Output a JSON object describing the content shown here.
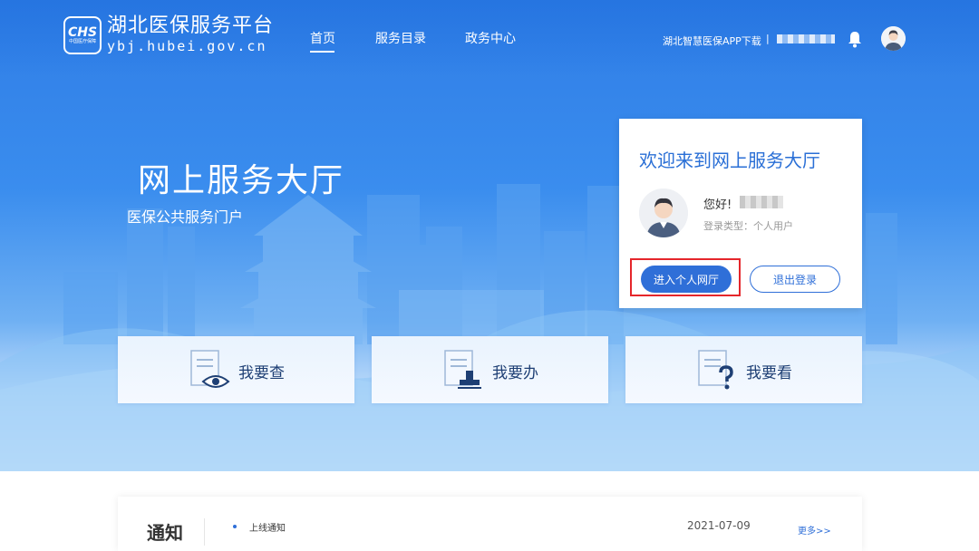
{
  "header": {
    "logo_badge": "CHS",
    "logo_badge_sub": "中国医疗保障",
    "site_name": "湖北医保服务平台",
    "site_domain": "ybj.hubei.gov.cn",
    "nav": [
      {
        "label": "首页",
        "active": true
      },
      {
        "label": "服务目录",
        "active": false
      },
      {
        "label": "政务中心",
        "active": false
      }
    ],
    "app_download": "湖北智慧医保APP下载",
    "separator": "|"
  },
  "hero": {
    "title": "网上服务大厅",
    "subtitle": "医保公共服务门户"
  },
  "login_card": {
    "welcome": "欢迎来到网上服务大厅",
    "greeting": "您好!",
    "login_type": "登录类型：个人用户",
    "enter_button": "进入个人网厅",
    "logout_button": "退出登录"
  },
  "services": [
    {
      "label": "我要查",
      "icon": "document-eye-icon"
    },
    {
      "label": "我要办",
      "icon": "document-stamp-icon"
    },
    {
      "label": "我要看",
      "icon": "document-question-icon"
    }
  ],
  "notice": {
    "title": "通知",
    "items": [
      {
        "text": "上线通知",
        "date": "2021-07-09"
      }
    ],
    "more": "更多>>"
  },
  "colors": {
    "primary": "#2f6fd8",
    "highlight": "#e5262b",
    "hero_blue": "#3a8dee"
  }
}
